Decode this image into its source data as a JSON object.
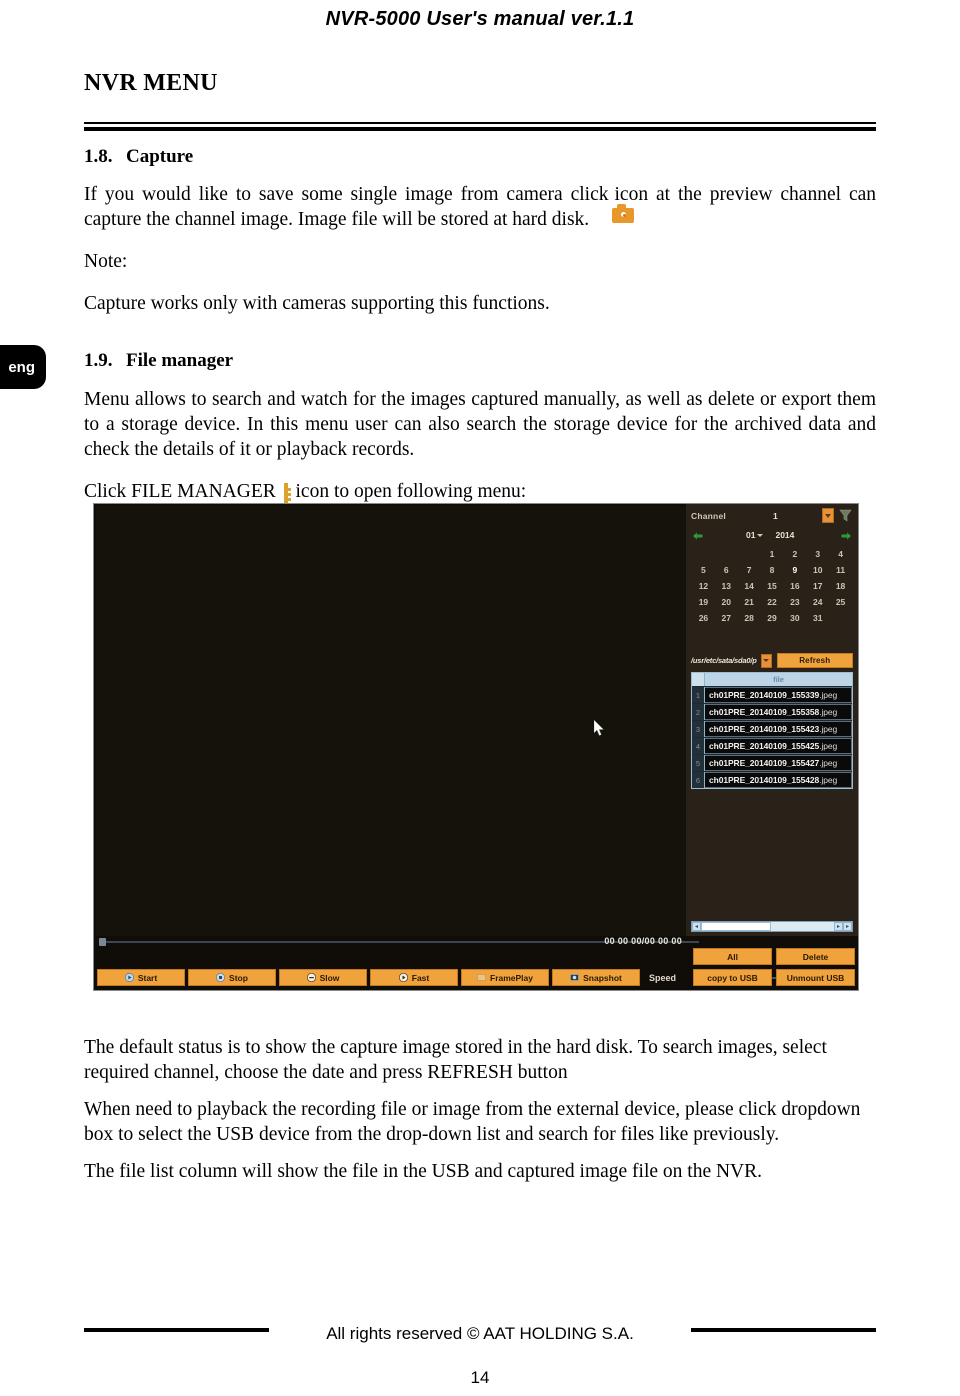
{
  "document": {
    "running_head": "NVR-5000 User's manual ver.1.1",
    "chapter_title": "NVR MENU",
    "language_tab": "eng",
    "page_number": "14",
    "footer_text": "All rights reserved © AAT HOLDING S.A."
  },
  "sections": [
    {
      "number": "1.8.",
      "heading": "Capture",
      "paragraphs": [
        {
          "before_icon": "If you would like to save some single image from camera click",
          "icon": "camera-icon",
          "after_icon": "icon at the preview channel can capture the channel image. Image file will be stored at hard disk."
        },
        {
          "text": "Note:"
        },
        {
          "text": "Capture works only with cameras supporting this functions."
        }
      ]
    },
    {
      "number": "1.9.",
      "heading": "File manager",
      "paragraphs": [
        {
          "text": "Menu allows to search and watch for the images captured manually, as well as delete or export them to a storage device. In this menu user can also search the storage device for the archived data and check the details of it or playback records."
        },
        {
          "before_icon": "Click FILE MANAGER",
          "icon": "file-manager-icon",
          "after_icon": "icon to open following menu:"
        }
      ],
      "trailing_paragraphs": [
        {
          "text": "The default status is to show the capture image stored in the hard disk. To search images, select required channel, choose the date and press REFRESH button"
        },
        {
          "text": "When need to playback the recording file or image from the external device, please click dropdown box to select the USB device from the drop-down list and search for files like previously."
        },
        {
          "text": "The file list column will show the file in the USB and captured image file on the NVR."
        }
      ]
    }
  ],
  "nvr_screenshot": {
    "channel": {
      "label": "Channel",
      "value": "1",
      "dropdown_icon": "chevron-down-icon",
      "filter_icon": "funnel-icon"
    },
    "calendar": {
      "prev_icon": "arrow-left-icon",
      "next_icon": "arrow-right-icon",
      "month": "01",
      "year": "2014",
      "selected_day": "9",
      "weeks": [
        [
          "",
          "",
          "",
          "1",
          "2",
          "3",
          "4"
        ],
        [
          "5",
          "6",
          "7",
          "8",
          "9",
          "10",
          "11"
        ],
        [
          "12",
          "13",
          "14",
          "15",
          "16",
          "17",
          "18"
        ],
        [
          "19",
          "20",
          "21",
          "22",
          "23",
          "24",
          "25"
        ],
        [
          "26",
          "27",
          "28",
          "29",
          "30",
          "31",
          ""
        ],
        [
          "",
          "",
          "",
          "",
          "",
          "",
          ""
        ]
      ]
    },
    "storage": {
      "path": "/usr/etc/sata/sda0/p",
      "dropdown_icon": "chevron-down-icon",
      "refresh_label": "Refresh"
    },
    "file_list": {
      "column_header": "file",
      "rows": [
        {
          "index": "1",
          "name": "ch01PRE_20140109_155339",
          "ext": ".jpeg"
        },
        {
          "index": "2",
          "name": "ch01PRE_20140109_155358",
          "ext": ".jpeg"
        },
        {
          "index": "3",
          "name": "ch01PRE_20140109_155423",
          "ext": ".jpeg"
        },
        {
          "index": "4",
          "name": "ch01PRE_20140109_155425",
          "ext": ".jpeg"
        },
        {
          "index": "5",
          "name": "ch01PRE_20140109_155427",
          "ext": ".jpeg"
        },
        {
          "index": "6",
          "name": "ch01PRE_20140109_155428",
          "ext": ".jpeg"
        }
      ],
      "scroll_left_glyph": "◂",
      "scroll_right_glyph": "▸",
      "scroll_right_glyph2": "▸"
    },
    "playback_controls": {
      "timecode": "00 00 00/00 00 00",
      "speed_label": "Speed",
      "buttons": [
        {
          "label": "Start",
          "icon": "play-circle-icon"
        },
        {
          "label": "Stop",
          "icon": "stop-circle-icon"
        },
        {
          "label": "Slow",
          "icon": "slow-circle-icon"
        },
        {
          "label": "Fast",
          "icon": "fast-circle-icon"
        },
        {
          "label": "FramePlay",
          "icon": "frame-icon"
        },
        {
          "label": "Snapshot",
          "icon": "snapshot-icon"
        }
      ]
    },
    "side_actions": [
      {
        "label": "All"
      },
      {
        "label": "Delete"
      },
      {
        "label": "copy to USB"
      },
      {
        "label": "Unmount USB"
      }
    ],
    "colors": {
      "button_orange": "#f0a23c",
      "panel_background": "#2a2218",
      "screen_background": "#15110b",
      "list_header_blue": "#bcd4e6"
    }
  }
}
